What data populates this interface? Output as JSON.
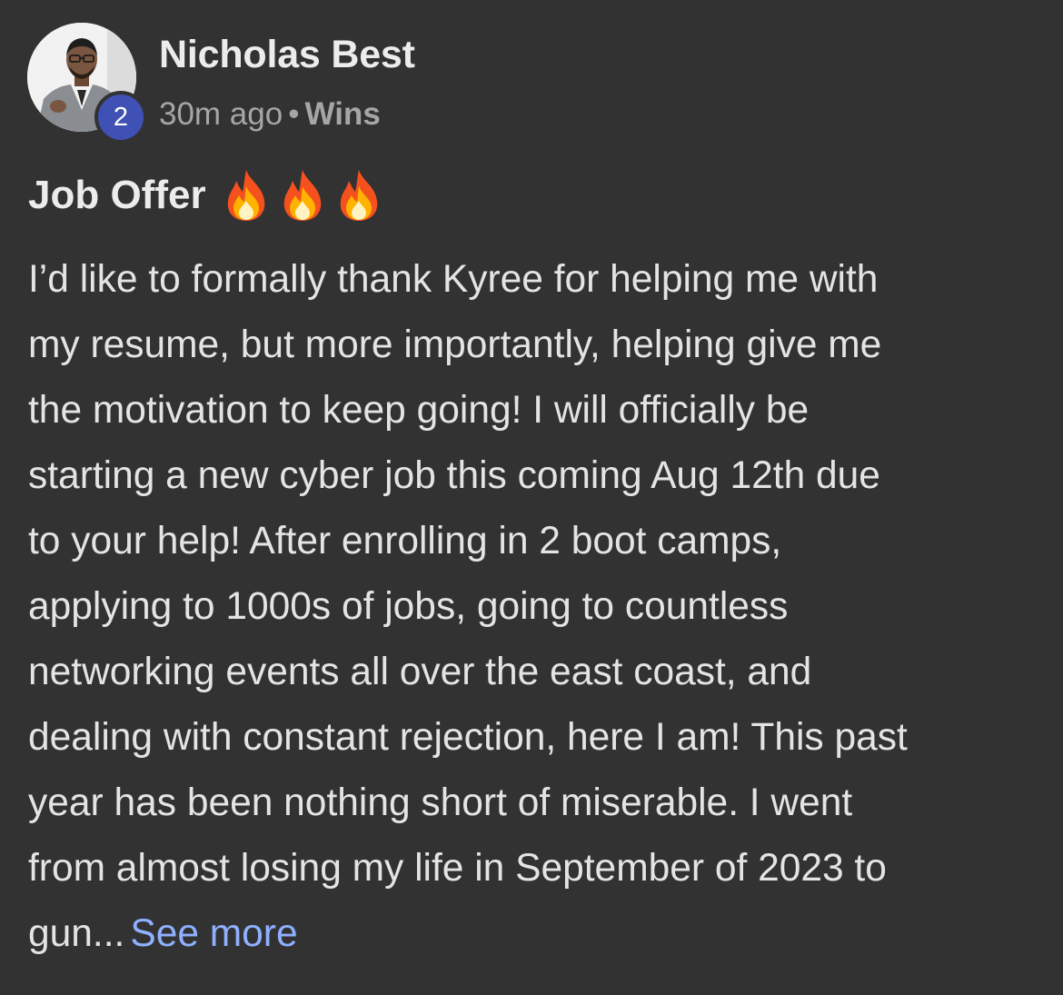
{
  "author": {
    "name": "Nicholas Best",
    "level": "2",
    "avatar_icon": "user-photo-avatar"
  },
  "meta": {
    "time": "30m ago",
    "separator": "•",
    "category": "Wins"
  },
  "post": {
    "title": "Job Offer",
    "title_emoji_icon": "fire-icon",
    "title_emoji_count": 3,
    "body_lines": [
      "I’d like to formally thank Kyree for helping me with",
      "my resume, but more importantly, helping give me",
      "the motivation to keep going! I will officially be",
      "starting a new cyber job this coming Aug 12th due",
      "to your help! After enrolling in 2 boot camps,",
      "applying to 1000s of jobs, going to countless",
      "networking events all over the east coast, and",
      "dealing with constant rejection, here I am! This past",
      "year has been nothing short of miserable. I went",
      "from almost losing my life in September of 2023 to",
      "gun..."
    ],
    "see_more_label": "See more"
  },
  "colors": {
    "background": "#323232",
    "badge": "#3f51b5",
    "link": "#8fb0ff",
    "meta_text": "#a6a6a6"
  }
}
